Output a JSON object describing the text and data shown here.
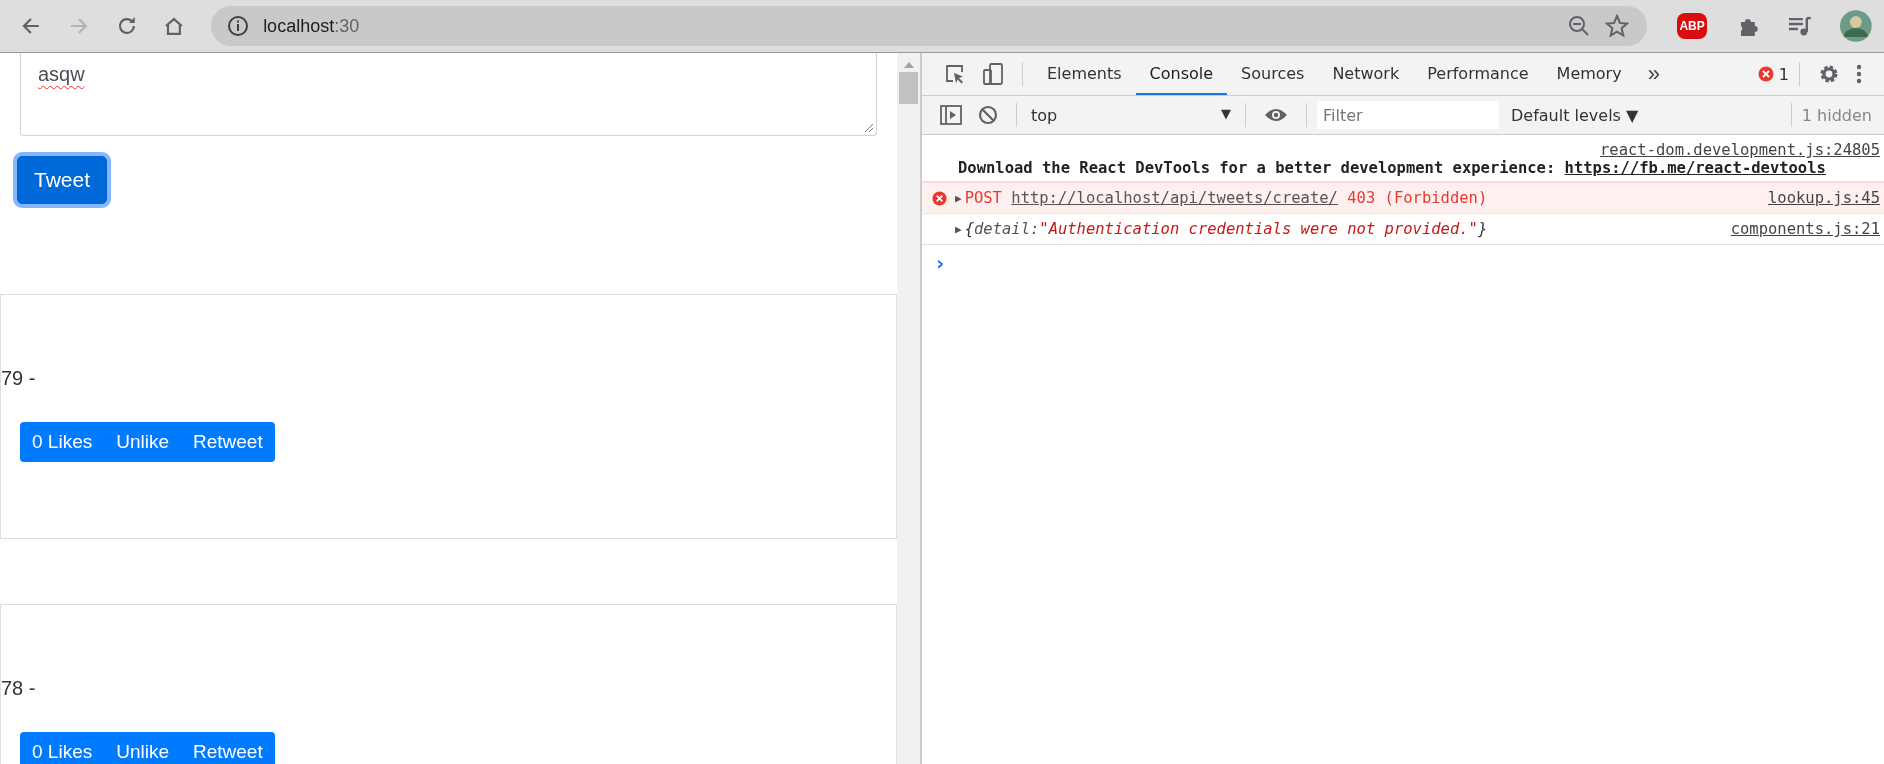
{
  "browser": {
    "forward_disabled": true,
    "address": {
      "host": "localhost",
      "port": ":30"
    },
    "adblock_badge": "ABP"
  },
  "page": {
    "composer": {
      "value": "asqw"
    },
    "tweet_button": "Tweet",
    "tweets": [
      {
        "text": "79 -",
        "actions": [
          "0 Likes",
          "Unlike",
          "Retweet"
        ]
      },
      {
        "text": "78 -",
        "actions": [
          "0 Likes",
          "Unlike",
          "Retweet"
        ]
      }
    ]
  },
  "devtools": {
    "tabs": [
      {
        "label": "Elements",
        "selected": false
      },
      {
        "label": "Console",
        "selected": true
      },
      {
        "label": "Sources",
        "selected": false
      },
      {
        "label": "Network",
        "selected": false
      },
      {
        "label": "Performance",
        "selected": false
      },
      {
        "label": "Memory",
        "selected": false
      }
    ],
    "more_tabs": "»",
    "error_count": "1",
    "toolbar": {
      "context": "top",
      "context_caret": "▼",
      "filter": {
        "placeholder": "Filter"
      },
      "levels": "Default levels",
      "levels_caret": "▼",
      "hidden": "1 hidden"
    },
    "messages": [
      {
        "kind": "info",
        "source": "react-dom.development.js:24805",
        "text": "Download the React DevTools for a better development experience: ",
        "link": "https://fb.me/react-devtools"
      },
      {
        "kind": "error",
        "source": "lookup.js:45",
        "toggle": "▶",
        "method": "POST",
        "url": "http://localhost/api/tweets/create/",
        "status": "403 (Forbidden)"
      },
      {
        "kind": "object",
        "source": "components.js:21",
        "toggle": "▶",
        "open": "{",
        "key": "detail:",
        "value": "\"Authentication credentials were not provided.\"",
        "close": "}"
      }
    ],
    "prompt": "›"
  }
}
